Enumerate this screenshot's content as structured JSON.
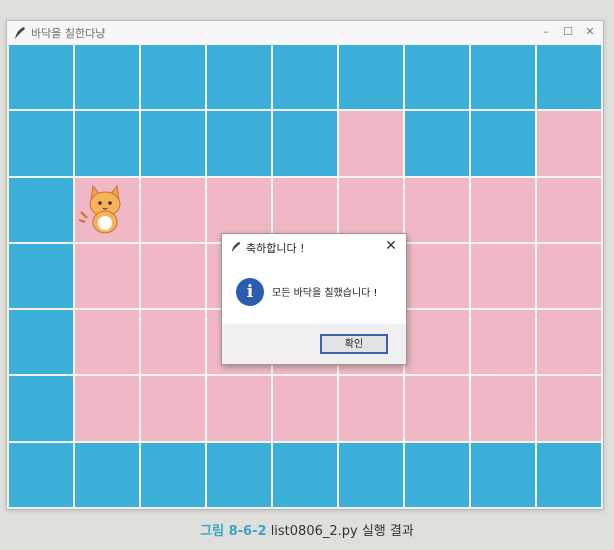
{
  "window": {
    "title": "바닥을 칠한다냥",
    "controls": {
      "minimize": "–",
      "maximize": "☐",
      "close": "✕"
    }
  },
  "board": {
    "rows": 7,
    "cols": 9,
    "colors": {
      "wall": "#3db0d9",
      "floor": "#f0b8c4",
      "grid_line": "#f4f4f4"
    },
    "map": [
      "#########",
      "#####.##.",
      "#........",
      "#........",
      "#........",
      "#........",
      "#########"
    ],
    "cat_cell": [
      2,
      1
    ]
  },
  "dialog": {
    "title": "축하합니다 !",
    "close_label": "✕",
    "icon": "info-icon",
    "icon_glyph": "i",
    "message": "모든 바닥을 칠했습니다 !",
    "ok_label": "확인"
  },
  "caption": {
    "figure": "그림 8-6-2",
    "text": "list0806_2.py 실행 결과"
  }
}
